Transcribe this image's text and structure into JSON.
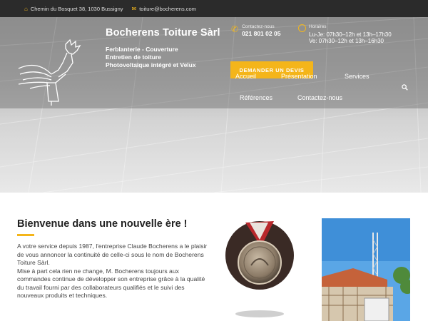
{
  "topbar": {
    "address": "Chemin du Bosquet 38, 1030 Bussigny",
    "email": "toiture@bocherens.com",
    "home_icon": "home-icon",
    "mail_icon": "mail-icon"
  },
  "brand": {
    "name": "Bocherens Toiture Sàrl",
    "tagline": [
      "Ferblanterie - Couverture",
      "Entretien de toiture",
      "Photovoltaïque intégré et Velux"
    ]
  },
  "contact": {
    "label": "Contactez-nous",
    "phone": "021 801 02 05",
    "icon": "phone-icon"
  },
  "hours": {
    "label": "Horaires",
    "lines": [
      "Lu-Je: 07h30–12h et 13h–17h30",
      "Ve:      07h30–12h et 13h–16h30"
    ],
    "icon": "clock-icon"
  },
  "cta": {
    "label": "DEMANDER UN DEVIS"
  },
  "nav": {
    "items": [
      "Accueil",
      "Présentation",
      "Services",
      "Références",
      "Contactez-nous"
    ],
    "search_icon": "search-icon"
  },
  "welcome": {
    "title": "Bienvenue dans une nouvelle ère !",
    "paragraphs": [
      "A votre service depuis 1987, l'entreprise Claude Bocherens a le plaisir de vous annoncer la continuité de celle-ci sous le nom de Bocherens Toiture Sàrl.",
      "Mise à part cela rien ne change, M. Bocherens toujours aux commandes continue de développer son entreprise grâce à la qualité du travail fourni par des collaborateurs qualifiés et le suivi des nouveaux produits et techniques."
    ]
  },
  "colors": {
    "accent": "#f4b51a",
    "topbar": "#2b2b2b",
    "text": "#444444"
  }
}
